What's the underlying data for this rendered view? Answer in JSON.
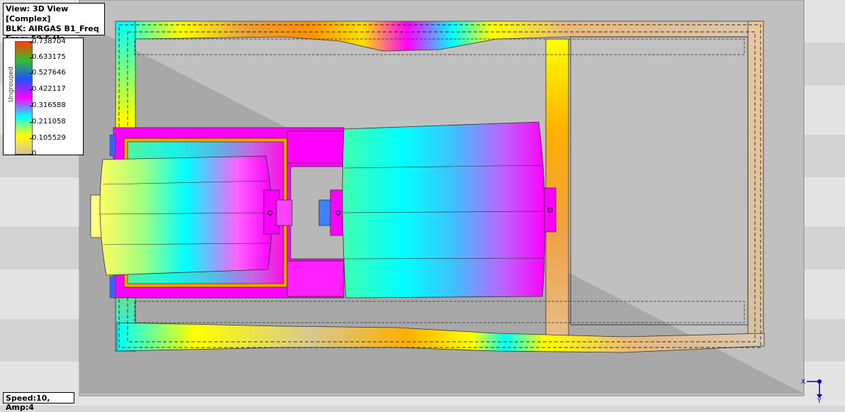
{
  "header": {
    "view_label": "View: 3D View [Complex]",
    "block_label": "BLK: AIRGAS B1_Freq",
    "freq_label": "Freq: 59.5 Hz"
  },
  "legend": {
    "group_label": "Ungrouped",
    "ticks": [
      "0.738704",
      "0.633175",
      "0.527646",
      "0.422117",
      "0.316588",
      "0.211058",
      "0.105529",
      "0"
    ],
    "colors": [
      "#ff3c00",
      "#30c030",
      "#2050ff",
      "#ff00ff",
      "#00ffff",
      "#ffff00",
      "#d8c0a0"
    ]
  },
  "status": {
    "text": "Speed:10, Amp:4"
  },
  "axis": {
    "x_label": "X",
    "y_label": "Y"
  }
}
